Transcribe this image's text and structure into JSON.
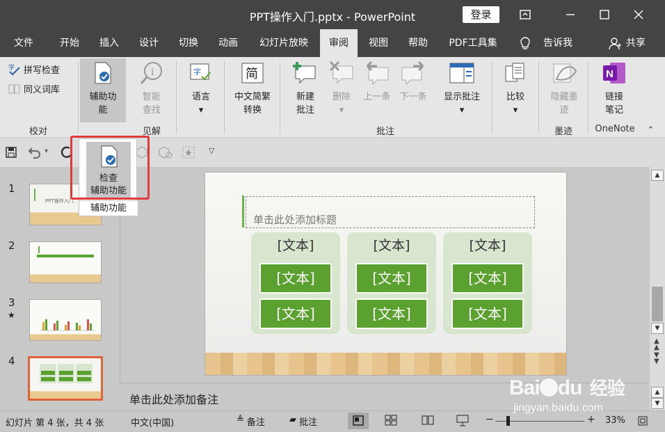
{
  "window": {
    "title": "PPT操作入门.pptx - PowerPoint",
    "login_label": "登录"
  },
  "menu": {
    "tabs": [
      {
        "label": "文件"
      },
      {
        "label": "开始"
      },
      {
        "label": "插入"
      },
      {
        "label": "设计"
      },
      {
        "label": "切换"
      },
      {
        "label": "动画"
      },
      {
        "label": "幻灯片放映"
      },
      {
        "label": "审阅"
      },
      {
        "label": "视图"
      },
      {
        "label": "帮助"
      },
      {
        "label": "PDF工具集"
      },
      {
        "label": "告诉我"
      },
      {
        "label": "共享"
      }
    ],
    "active": "审阅"
  },
  "ribbon": {
    "spell_check": "拼写检查",
    "thesaurus": "同义词库",
    "group_proofing": "校对",
    "accessibility_line1": "辅助功",
    "accessibility_line2": "能",
    "smart_lookup_line1": "智能",
    "smart_lookup_line2": "查找",
    "group_insights": "见解",
    "language": "语言",
    "chinese_convert_line1": "中文简繁",
    "chinese_convert_line2": "转换",
    "new_comment_line1": "新建",
    "new_comment_line2": "批注",
    "delete": "删除",
    "previous": "上一条",
    "next": "下一条",
    "show_comments": "显示批注",
    "group_comments": "批注",
    "compare": "比较",
    "hide_ink_line1": "隐藏墨",
    "hide_ink_line2": "迹",
    "group_ink": "墨迹",
    "linked_notes_line1": "链接",
    "linked_notes_line2": "笔记",
    "group_onenote": "OneNote",
    "icon_simplified": "简"
  },
  "popup": {
    "check_line1": "检查",
    "check_line2": "辅助功能",
    "group_label": "辅助功能"
  },
  "slides": [
    {
      "number": "1",
      "star": ""
    },
    {
      "number": "2",
      "star": ""
    },
    {
      "number": "3",
      "star": "★"
    },
    {
      "number": "4",
      "star": ""
    }
  ],
  "thumb1_title": "PPT操作入门",
  "slide": {
    "title_placeholder": "单击此处添加标题",
    "column_head": "[文本]",
    "box_text": "[文本]"
  },
  "notes_placeholder": "单击此处添加备注",
  "status": {
    "slide_info": "幻灯片 第 4 张，共 4 张",
    "language": "中文(中国)",
    "notes": "备注",
    "comments": "批注",
    "zoom": "33%"
  },
  "watermark": {
    "brand": "Bai",
    "brand2": "du",
    "cn": "经验",
    "url": "jingyan.baidu.com"
  },
  "colors": {
    "titlebar": "#444444",
    "accent_green": "#5aa12f",
    "highlight_red": "#e03a3a"
  }
}
